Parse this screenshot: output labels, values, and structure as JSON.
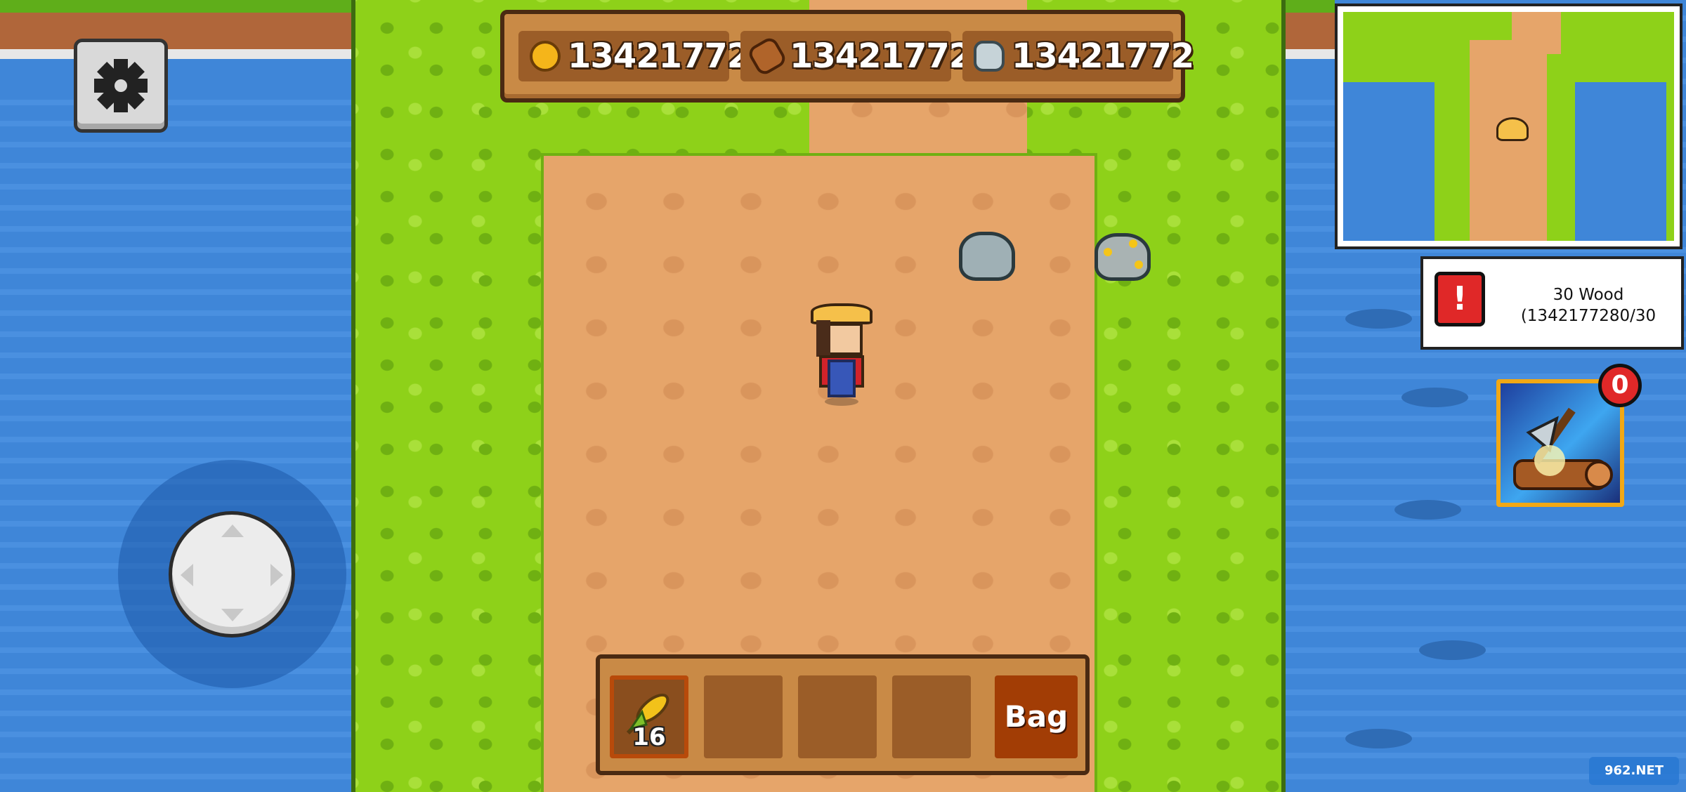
{
  "resources": {
    "coins": {
      "icon": "coin-icon",
      "value": "13421772"
    },
    "wood": {
      "icon": "wood-log-icon",
      "value": "13421772"
    },
    "stone": {
      "icon": "stone-icon",
      "value": "13421772"
    }
  },
  "settings": {
    "icon": "gear-icon"
  },
  "quest": {
    "icon_label": "!",
    "title": "30 Wood",
    "progress": "(1342177280/30"
  },
  "skill": {
    "icon": "axe-chop-skill-icon",
    "badge_count": "0"
  },
  "hotbar": {
    "slots": [
      {
        "icon": "wheat-seed-icon",
        "count": "16",
        "selected": true
      },
      {
        "icon": "",
        "count": ""
      },
      {
        "icon": "",
        "count": ""
      },
      {
        "icon": "",
        "count": ""
      }
    ],
    "bag_label": "Bag"
  },
  "watermark": "962.NET"
}
